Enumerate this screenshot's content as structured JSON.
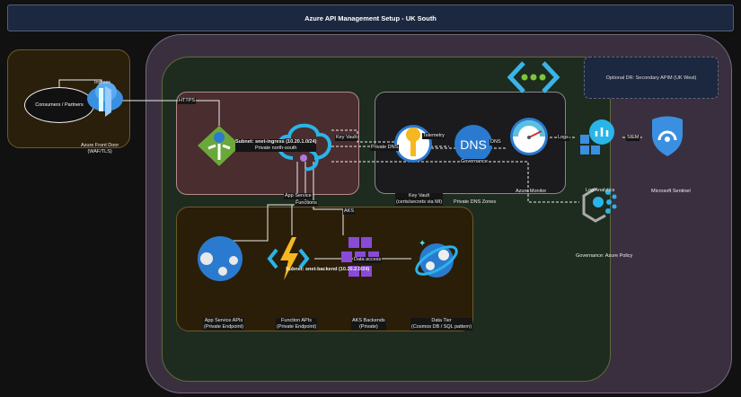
{
  "title": "Azure API Management Setup - UK South",
  "front_door": {
    "consumers": "Consumers / Partners",
    "ingress": "Ingress",
    "label_line1": "Azure Front Door",
    "label_line2": "(WAF/TLS)"
  },
  "edges": {
    "https": "HTTPS",
    "key_vault": "Key Vault",
    "private_dns": "Private DNS",
    "telemetry": "Telemetry",
    "governance": "Governance",
    "logs": "Logs",
    "siem": "SIEM",
    "app_service": "App Service",
    "functions": "Functions",
    "aks": "AKS",
    "data_access": "Data access",
    "dns_fwd": "DNS"
  },
  "subnets": {
    "ingress_line1": "Subnet: snet-ingress (10.20.1.0/24)",
    "ingress_line2": "Private north-south",
    "backend": "Subnet: snet-backend (10.20.2.0/24)"
  },
  "nodes": {
    "key_vault": [
      "Key Vault",
      "(certs/secrets via MI)"
    ],
    "private_dns": "Private DNS Zones",
    "monitor": "Azure Monitor",
    "log_analytics": "Log Analytics",
    "sentinel": "Microsoft Sentinel",
    "policy": "Governance: Azure Policy",
    "dr": "Optional DR: Secondary APIM (UK West)",
    "app_service": [
      "App Service APIs",
      "(Private Endpoint)"
    ],
    "functions": [
      "Function APIs",
      "(Private Endpoint)"
    ],
    "aks": [
      "AKS Backends",
      "(Private)"
    ],
    "data": [
      "Data Tier",
      "(Cosmos DB / SQL pattern)"
    ]
  },
  "colors": {
    "region": "#3a2f3f",
    "vnet": "#1e2b1f",
    "ingress_subnet": "#4a2d2e",
    "backend_subnet": "#2a1e08",
    "monitoring": "#1b1a1c",
    "title_bar": "#1c2840"
  }
}
